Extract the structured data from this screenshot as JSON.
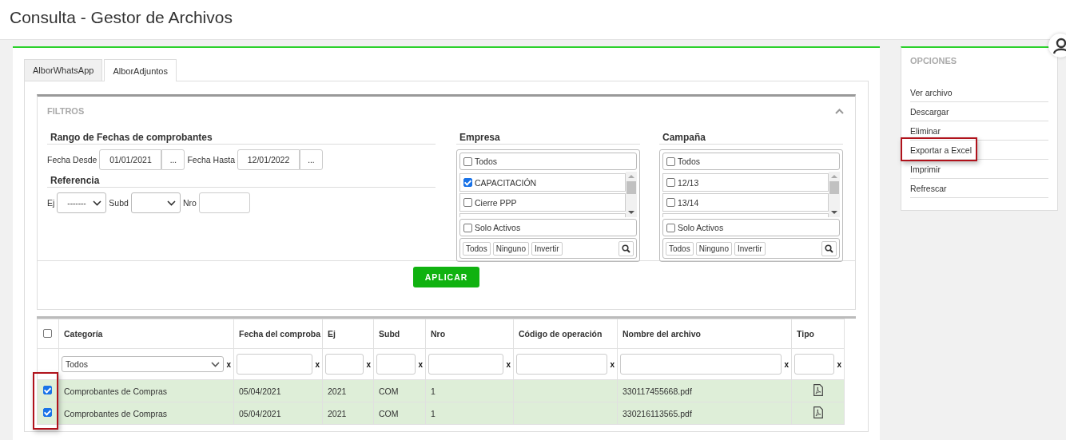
{
  "page": {
    "title": "Consulta - Gestor de Archivos"
  },
  "tabs": [
    {
      "label": "AlborWhatsApp",
      "selected": false
    },
    {
      "label": "AlborAdjuntos",
      "selected": true
    }
  ],
  "filters": {
    "title": "FILTROS",
    "expanded": true,
    "date_range": {
      "heading": "Rango de Fechas de comprobantes",
      "from_label": "Fecha Desde",
      "from_value": "01/01/2021",
      "from_picker": "...",
      "to_label": "Fecha Hasta",
      "to_value": "12/01/2022",
      "to_picker": "..."
    },
    "reference": {
      "heading": "Referencia",
      "ej_label": "Ej",
      "ej_value": "-------",
      "subd_label": "Subd",
      "nro_label": "Nro"
    },
    "lists": [
      {
        "heading": "Empresa",
        "all": {
          "label": "Todos",
          "checked": false
        },
        "items": [
          {
            "label": "CAPACITACIÓN",
            "checked": true
          },
          {
            "label": "Cierre PPP",
            "checked": false
          }
        ],
        "only_active": {
          "label": "Solo Activos",
          "checked": false
        },
        "buttons": [
          "Todos",
          "Ninguno",
          "Invertir"
        ]
      },
      {
        "heading": "Campaña",
        "all": {
          "label": "Todos",
          "checked": false
        },
        "items": [
          {
            "label": "12/13",
            "checked": false
          },
          {
            "label": "13/14",
            "checked": false
          }
        ],
        "only_active": {
          "label": "Solo Activos",
          "checked": false
        },
        "buttons": [
          "Todos",
          "Ninguno",
          "Invertir"
        ]
      }
    ],
    "apply_button": "APLICAR"
  },
  "table": {
    "select_all_checked": false,
    "rows_highlighted": true,
    "columns": [
      {
        "label": "Categoría",
        "kind": "select",
        "filter_value": "Todos",
        "clear": "x"
      },
      {
        "label": "Fecha del comproba",
        "kind": "text",
        "clear": "x"
      },
      {
        "label": "Ej",
        "kind": "text",
        "clear": "x"
      },
      {
        "label": "Subd",
        "kind": "text",
        "clear": "x"
      },
      {
        "label": "Nro",
        "kind": "text",
        "clear": "x"
      },
      {
        "label": "Código de operación",
        "kind": "text",
        "clear": "x"
      },
      {
        "label": "Nombre del archivo",
        "kind": "text",
        "clear": "x"
      },
      {
        "label": "Tipo",
        "kind": "text",
        "clear": "x"
      }
    ],
    "rows": [
      {
        "selected": true,
        "cells": [
          "Comprobantes de Compras",
          "05/04/2021",
          "2021",
          "COM",
          "1",
          "",
          "330117455668.pdf"
        ],
        "kind": "pdf"
      },
      {
        "selected": true,
        "cells": [
          "Comprobantes de Compras",
          "05/04/2021",
          "2021",
          "COM",
          "1",
          "",
          "330216113565.pdf"
        ],
        "kind": "pdf"
      }
    ]
  },
  "options": {
    "title": "OPCIONES",
    "items": [
      {
        "label": "Ver archivo",
        "highlighted": false
      },
      {
        "label": "Descargar",
        "highlighted": false
      },
      {
        "label": "Eliminar",
        "highlighted": false
      },
      {
        "label": "Exportar a Excel",
        "highlighted": true
      },
      {
        "label": "Imprimir",
        "highlighted": false
      },
      {
        "label": "Refrescar",
        "highlighted": false
      }
    ]
  }
}
